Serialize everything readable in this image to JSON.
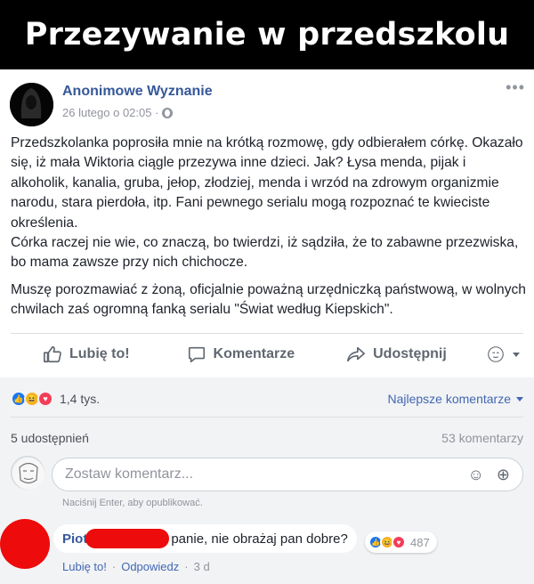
{
  "header": {
    "title": "Przezywanie w przedszkolu"
  },
  "post": {
    "author": "Anonimowe Wyznanie",
    "date": "26 lutego o 02:05 ·",
    "more": "•••",
    "paragraph1": "Przedszkolanka poprosiła mnie na krótką rozmowę, gdy odbierałem córkę. Okazało się, iż mała Wiktoria ciągle przezywa inne dzieci. Jak? Łysa menda, pijak i alkoholik, kanalia, gruba, jełop, złodziej, menda i wrzód na zdrowym organizmie narodu, stara pierdoła, itp. Fani pewnego serialu mogą rozpoznać te kwieciste określenia.\nCórka raczej nie wie, co znaczą, bo twierdzi, iż sądziła, że to zabawne przezwiska, bo mama zawsze przy nich chichocze.",
    "paragraph2": "Muszę porozmawiać z żoną, oficjalnie poważną urzędniczką państwową, w wolnych chwilach zaś ogromną fanką serialu \"Świat według Kiepskich\"."
  },
  "actions": {
    "like": "Lubię to!",
    "comment": "Komentarze",
    "share": "Udostępnij"
  },
  "stats": {
    "reactions_count": "1,4 tys.",
    "sort_label": "Najlepsze komentarze",
    "shares": "5 udostępnień",
    "comments": "53 komentarzy"
  },
  "composer": {
    "placeholder": "Zostaw komentarz...",
    "hint": "Naciśnij Enter, aby opublikować."
  },
  "comment": {
    "name_visible": "Piot",
    "text": "panie, nie obrażaj pan dobre?",
    "reaction_count": "487",
    "like": "Lubię to!",
    "reply": "Odpowiedz",
    "separator": "·",
    "age": "3 d"
  },
  "colors": {
    "link_blue": "#365899",
    "accent_blue": "#4267b2",
    "redaction_red": "#ee0b0b"
  }
}
